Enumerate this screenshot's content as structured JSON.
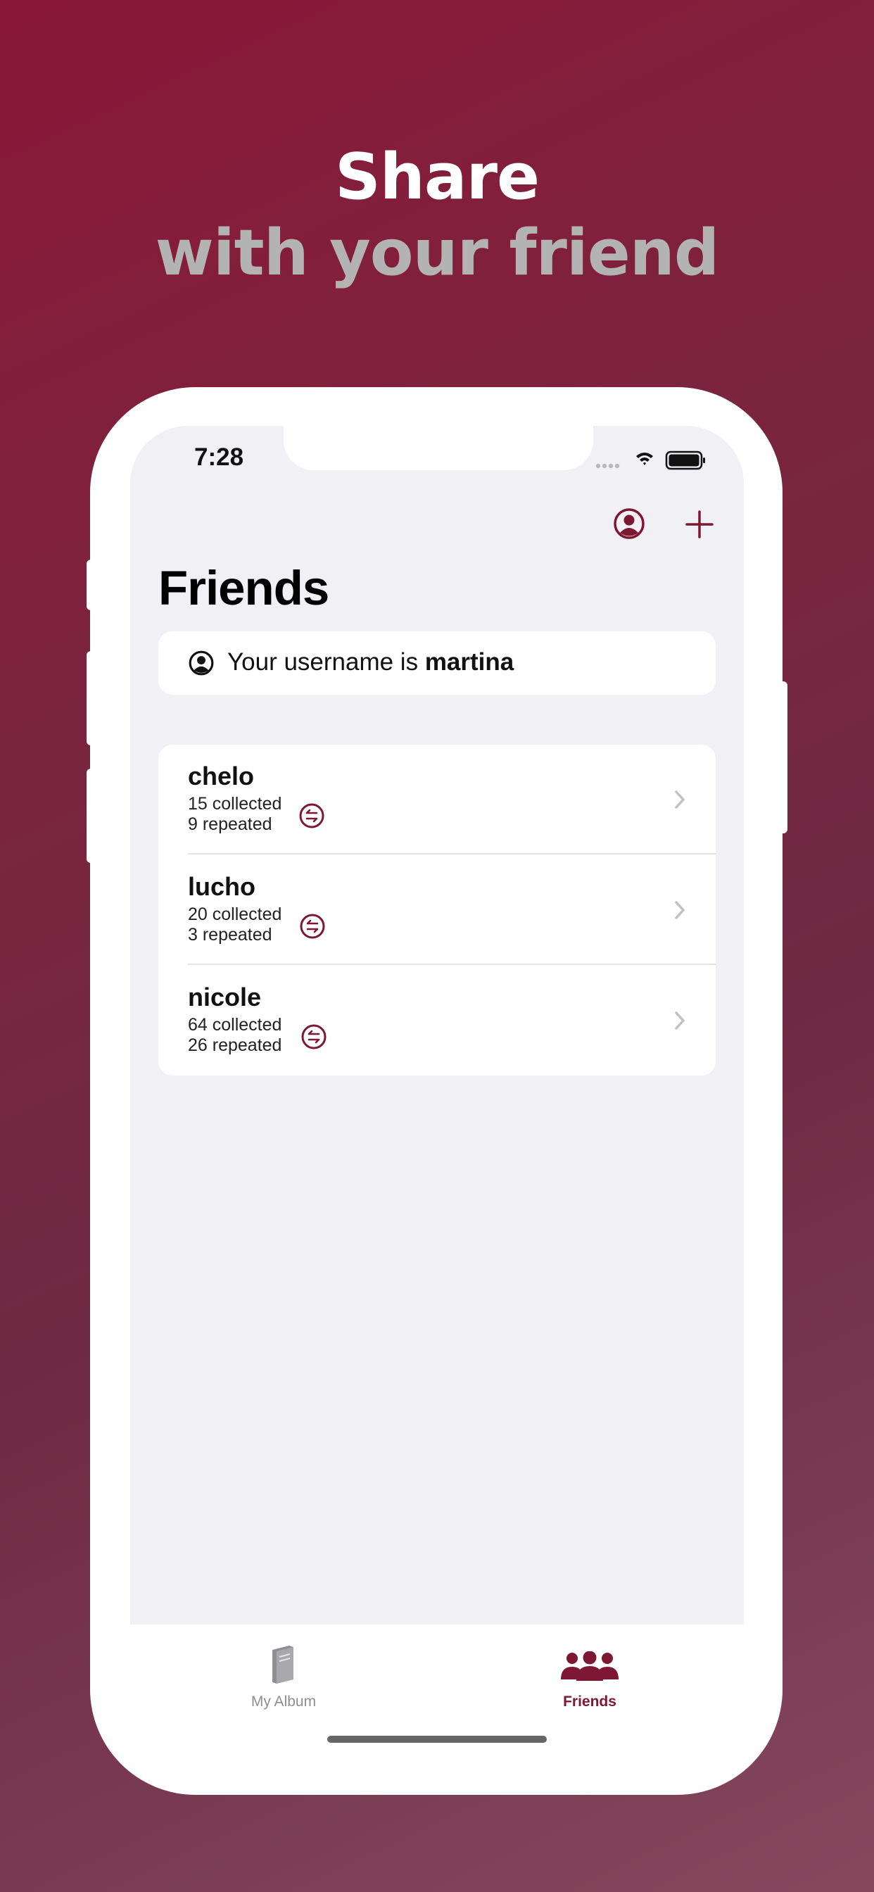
{
  "promo": {
    "line1": "Share",
    "line2": "with your friend"
  },
  "status_bar": {
    "time": "7:28"
  },
  "nav": {
    "title": "Friends",
    "profile_icon": "person-circle-icon",
    "add_icon": "plus-icon"
  },
  "username_card": {
    "prefix": "Your username is ",
    "username": "martina",
    "icon": "person-circle-icon"
  },
  "friends": [
    {
      "name": "chelo",
      "collected": "15 collected",
      "repeated": "9 repeated"
    },
    {
      "name": "lucho",
      "collected": "20 collected",
      "repeated": "3 repeated"
    },
    {
      "name": "nicole",
      "collected": "64 collected",
      "repeated": "26 repeated"
    }
  ],
  "tabbar": {
    "tabs": [
      {
        "label": "My Album",
        "icon": "book-icon",
        "selected": false
      },
      {
        "label": "Friends",
        "icon": "people-icon",
        "selected": true
      }
    ]
  },
  "colors": {
    "accent": "#7d1733",
    "background_gradient_start": "#8a1838",
    "background_gradient_end": "#86485d",
    "screen_bg": "#f1f0f5",
    "tab_inactive": "#8e8e93"
  }
}
